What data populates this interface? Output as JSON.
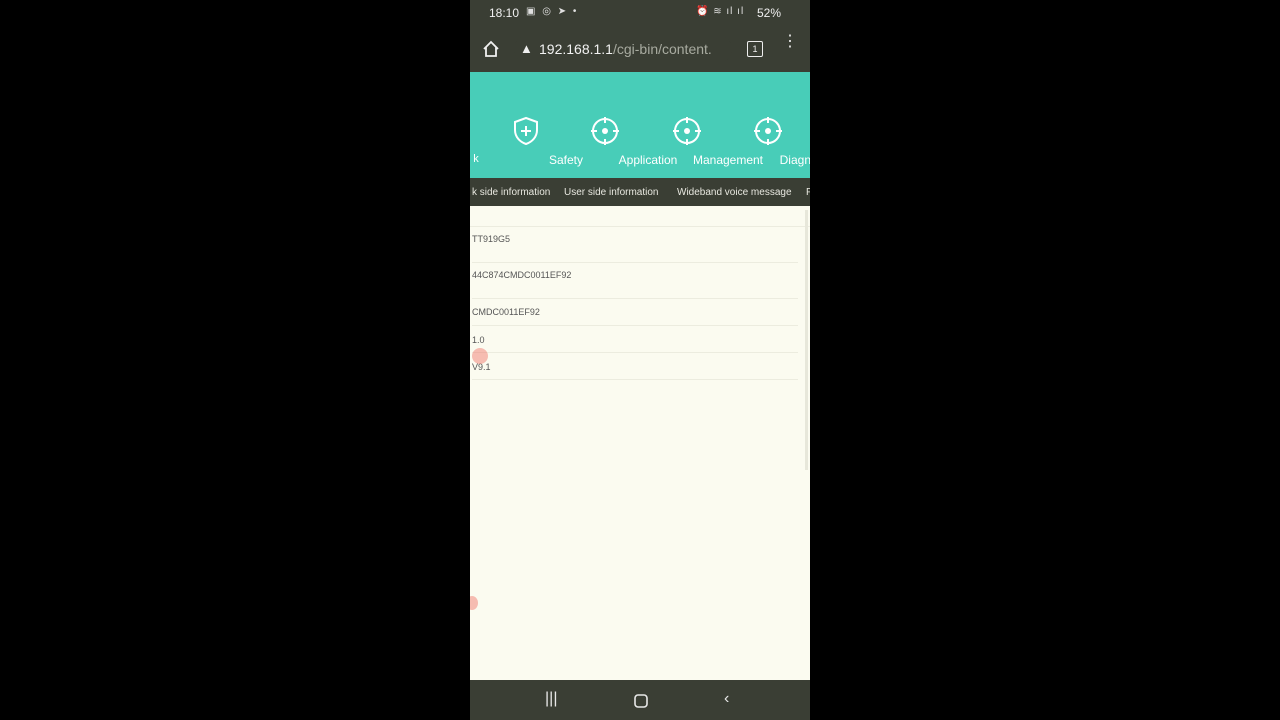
{
  "status_bar": {
    "time": "18:10",
    "battery": "52%",
    "left_icons": [
      "video-icon",
      "wifi-call-icon",
      "telegram-icon",
      "dot-icon"
    ],
    "right_icons": [
      "alarm-icon",
      "wifi-icon",
      "signal-icon",
      "signal-icon"
    ]
  },
  "address_bar": {
    "warning_icon": "warning-icon",
    "url_host": "192.168.1.1",
    "url_path": "/cgi-bin/content.",
    "tab_count": "1"
  },
  "top_nav": {
    "partial_label": "k",
    "items": [
      {
        "label": "Safety",
        "icon": "shield-plus-icon"
      },
      {
        "label": "Application",
        "icon": "crosshair-icon"
      },
      {
        "label": "Management",
        "icon": "crosshair-icon"
      },
      {
        "label": "Diagnosis",
        "icon": "crosshair-icon"
      }
    ],
    "accent_color": "#48cdb8"
  },
  "sub_tabs": [
    {
      "label": "k side information"
    },
    {
      "label": "User side information"
    },
    {
      "label": "Wideband voice message"
    },
    {
      "label": "F"
    }
  ],
  "info_rows": [
    {
      "value": "TT919G5"
    },
    {
      "value": "44C874CMDC0011EF92"
    },
    {
      "value": "CMDC0011EF92"
    },
    {
      "value": "1.0"
    },
    {
      "value": "V9.1"
    }
  ],
  "nav_bar": {
    "recent": "recent-apps-icon",
    "home": "home-circle-icon",
    "back": "back-icon"
  }
}
